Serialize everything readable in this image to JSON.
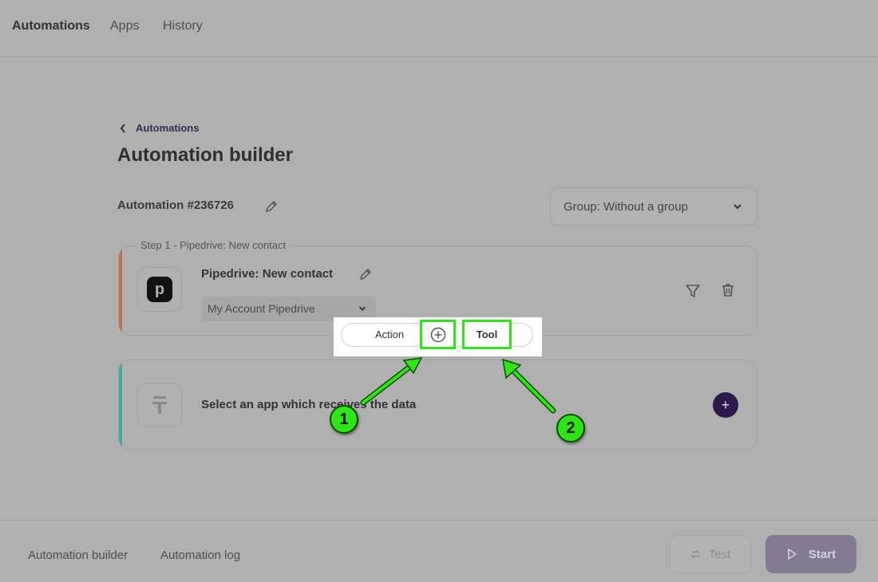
{
  "topnav": {
    "items": [
      {
        "label": "Automations",
        "active": true
      },
      {
        "label": "Apps",
        "active": false
      },
      {
        "label": "History",
        "active": false
      }
    ]
  },
  "breadcrumb": {
    "back_label": "Automations",
    "icon": "chevron-left-icon"
  },
  "page": {
    "title": "Automation builder"
  },
  "automation": {
    "name": "Automation #236726",
    "edit_icon": "pencil-icon"
  },
  "group_select": {
    "value": "Group: Without a group"
  },
  "step1": {
    "legend": "Step 1 - Pipedrive: New contact",
    "trigger_name": "Pipedrive: New contact",
    "app_logo_letter": "p",
    "account": "My Account Pipedrive",
    "icons": [
      "filter-icon",
      "trash-icon"
    ],
    "accent_color": "#c0704c"
  },
  "step2": {
    "prompt": "Select an app which receives the data",
    "add_label": "+",
    "accent_color": "#3ea89a"
  },
  "popup": {
    "action_label": "Action",
    "tool_label": "Tool",
    "plus_icon": "plus-circle-icon"
  },
  "annotations": [
    {
      "label": "1"
    },
    {
      "label": "2"
    }
  ],
  "bottom": {
    "tabs": [
      "Automation builder",
      "Automation log"
    ],
    "test_label": "Test",
    "start_label": "Start"
  },
  "colors": {
    "highlight": "#2ee617",
    "start_button": "#847a93",
    "add_button": "#2c1a4a"
  }
}
